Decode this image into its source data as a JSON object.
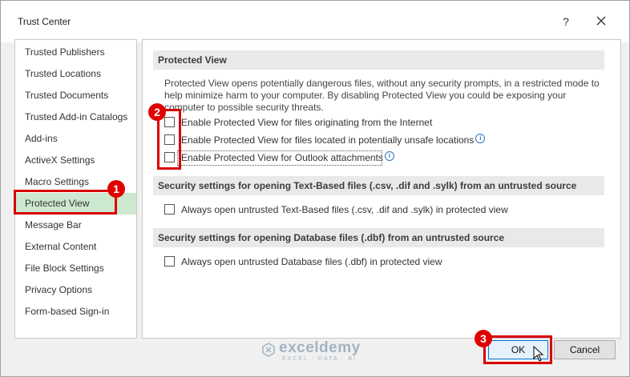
{
  "window": {
    "title": "Trust Center",
    "help_glyph": "?",
    "close_icon": "close-icon"
  },
  "nav": {
    "selected": "Protected View",
    "items": [
      "Trusted Publishers",
      "Trusted Locations",
      "Trusted Documents",
      "Trusted Add-in Catalogs",
      "Add-ins",
      "ActiveX Settings",
      "Macro Settings",
      "Protected View",
      "Message Bar",
      "External Content",
      "File Block Settings",
      "Privacy Options",
      "Form-based Sign-in"
    ]
  },
  "protected_view": {
    "header": "Protected View",
    "description": "Protected View opens potentially dangerous files, without any security prompts, in a restricted mode to help minimize harm to your computer. By disabling Protected View you could be exposing your computer to possible security threats.",
    "options": [
      {
        "label": "Enable Protected View for files originating from the Internet",
        "checked": false,
        "info": false
      },
      {
        "label": "Enable Protected View for files located in potentially unsafe locations",
        "checked": false,
        "info": true
      },
      {
        "label": "Enable Protected View for Outlook attachments",
        "checked": false,
        "info": true
      }
    ]
  },
  "text_based": {
    "header": "Security settings for opening Text-Based files (.csv, .dif and .sylk) from an untrusted source",
    "option": "Always open untrusted Text-Based files (.csv, .dif and .sylk) in protected view",
    "checked": false
  },
  "database": {
    "header": "Security settings for opening Database files (.dbf) from an untrusted source",
    "option": "Always open untrusted Database files (.dbf) in protected view",
    "checked": false
  },
  "buttons": {
    "ok": "OK",
    "cancel": "Cancel"
  },
  "annotations": {
    "step1": "1",
    "step2": "2",
    "step3": "3",
    "color": "#d90000"
  },
  "watermark": {
    "name": "exceldemy",
    "tagline": "EXCEL · DATA · BI"
  },
  "colors": {
    "selected_bg": "#cce8cf",
    "header_bg": "#e9e9e9",
    "info_blue": "#2f74c0",
    "ok_border": "#0078d7"
  }
}
